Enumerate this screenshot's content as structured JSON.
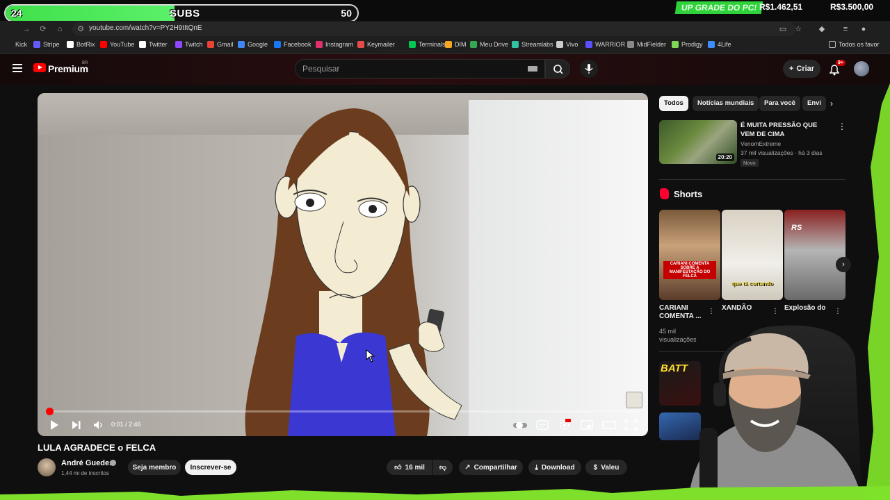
{
  "overlay": {
    "sub_count": "24",
    "sub_label": "SUBS",
    "sub_target": "50",
    "sub_progress": 0.48,
    "upgrade_label": "UP GRADE DO PC!",
    "upgrade_current": "R$1.462,51",
    "upgrade_goal": "R$3.500,00"
  },
  "browser": {
    "url": "youtube.com/watch?v=PY2H9tItQnE",
    "bookmarks": [
      {
        "label": "Kick",
        "color": "#53fc18"
      },
      {
        "label": "Stripe",
        "color": "#635bff"
      },
      {
        "label": "BotRix",
        "color": "#ffffff"
      },
      {
        "label": "YouTube",
        "color": "#ff0000"
      },
      {
        "label": "Twitter",
        "color": "#ffffff"
      },
      {
        "label": "Twitch",
        "color": "#9146ff"
      },
      {
        "label": "Gmail",
        "color": "#ea4335"
      },
      {
        "label": "Google",
        "color": "#4285f4"
      },
      {
        "label": "Facebook",
        "color": "#1877f2"
      },
      {
        "label": "Instagram",
        "color": "#e1306c"
      },
      {
        "label": "Keymailer",
        "color": "#e54b4b"
      },
      {
        "label": "Terminals",
        "color": "#00c853"
      },
      {
        "label": "DIM",
        "color": "#f5a623"
      },
      {
        "label": "Meu Drive",
        "color": "#34a853"
      },
      {
        "label": "Streamlabs",
        "color": "#31c3a2"
      },
      {
        "label": "Vivo",
        "color": "#cccccc"
      },
      {
        "label": "WARRIOR",
        "color": "#5b4fff"
      },
      {
        "label": "MidFielder",
        "color": "#888888"
      },
      {
        "label": "Prodigy",
        "color": "#7ed957"
      },
      {
        "label": "4Life",
        "color": "#3f8cff"
      }
    ],
    "all_favorites": "Todos os favor"
  },
  "youtube": {
    "brand": "Premium",
    "country": "BR",
    "search_placeholder": "Pesquisar",
    "create_label": "Criar",
    "notifications": "9+"
  },
  "player": {
    "time": "0:01 / 2:46",
    "progress": 0.006
  },
  "video": {
    "title": "LULA AGRADECE o FELCA",
    "channel": "André Guedes",
    "subscribers": "1,44 mi de inscritos",
    "member_label": "Seja membro",
    "subscribe_label": "Inscrever-se",
    "likes": "16 mil",
    "share_label": "Compartilhar",
    "download_label": "Download",
    "thanks_label": "Valeu"
  },
  "sidebar": {
    "chips": [
      "Todos",
      "Notícias mundiais",
      "Para você",
      "Envi"
    ],
    "recommendation": {
      "title": "É MUITA PRESSÃO QUE VEM DE CIMA",
      "channel": "VenomExtreme",
      "meta": "37 mil visualizações · há 3 dias",
      "badge": "Novo",
      "duration": "20:20"
    },
    "shorts_label": "Shorts",
    "shorts": [
      {
        "title": "CARIANI COMENTA ...",
        "views": "45 mil visualizações",
        "caption": "CARIANI COMENTA SOBRE A MANIFESTAÇÃO DO FELCA"
      },
      {
        "title": "XANDÃO",
        "caption": "que tá cortando"
      },
      {
        "title": "Explosão do",
        "caption": "RS"
      }
    ],
    "bottom_thumb_text": "BATT"
  }
}
